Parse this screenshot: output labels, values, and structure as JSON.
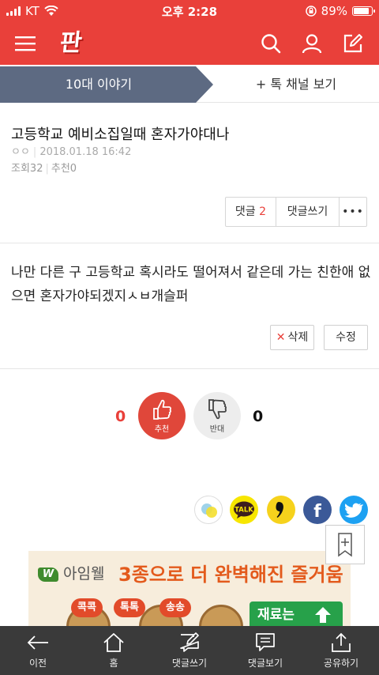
{
  "status_bar": {
    "carrier": "KT",
    "time": "오후 2:28",
    "battery": "89%",
    "battery_level": 0.89
  },
  "header": {
    "logo": "판",
    "icons": [
      "menu-icon",
      "search-icon",
      "user-icon",
      "edit-icon"
    ]
  },
  "tabs": {
    "active": "10대 이야기",
    "other": "+ 톡 채널 보기"
  },
  "post": {
    "title": "고등학교 예비소집일때 혼자가야대나",
    "author": "ㅇㅇ",
    "date": "2018.01.18 16:42",
    "views_label": "조회",
    "views": "32",
    "likes_label": "추천",
    "likes": "0",
    "body": "나만 다른 구 고등학교 혹시라도 떨어져서 같은데 가는 친한애 없으면 혼자가야되겠지ㅅㅂ개슬퍼"
  },
  "comment_actions": {
    "comments_label": "댓글",
    "comments_count": "2",
    "write_label": "댓글쓰기",
    "more_label": "•••"
  },
  "post_actions": {
    "delete_label": "삭제",
    "edit_label": "수정"
  },
  "votes": {
    "up_count": "0",
    "up_label": "추천",
    "down_count": "0",
    "down_label": "반대"
  },
  "share": {
    "icons": [
      "kakaostory-icon",
      "kakaotalk-icon",
      "band-icon",
      "facebook-icon",
      "twitter-icon"
    ],
    "kakaotalk_text": "TALK",
    "facebook_text": "f",
    "band_text": "❜"
  },
  "ad": {
    "brand": "아임웰",
    "brand_mark": "W",
    "headline": "3종으로 더 완벽해진 즐거움",
    "chips": [
      "콕콕",
      "톡톡",
      "송송"
    ],
    "cta": "재료는"
  },
  "bottom_bar": {
    "items": [
      {
        "label": "이전",
        "icon": "back-arrow-icon"
      },
      {
        "label": "홈",
        "icon": "home-icon"
      },
      {
        "label": "댓글쓰기",
        "icon": "write-comment-icon"
      },
      {
        "label": "댓글보기",
        "icon": "view-comments-icon"
      },
      {
        "label": "공유하기",
        "icon": "share-icon"
      }
    ]
  },
  "colors": {
    "brand": "#e9403a",
    "tab_active": "#5d6a82",
    "toolbar": "#3a3a3a",
    "facebook": "#3b5998",
    "twitter": "#1da1f2",
    "kakao": "#f7e600"
  }
}
